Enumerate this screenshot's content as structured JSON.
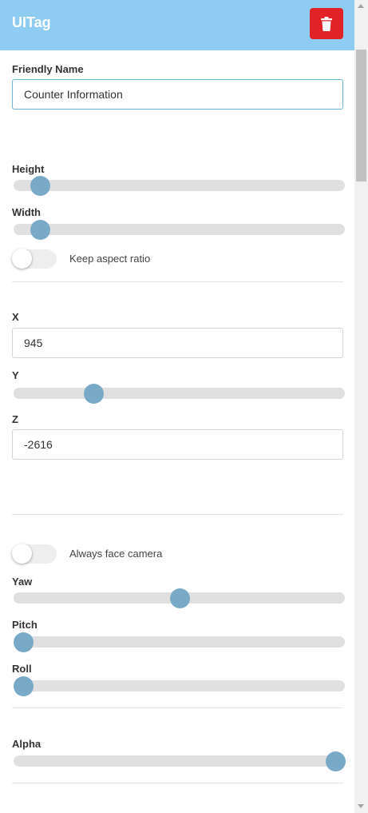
{
  "header": {
    "title": "UITag",
    "delete_icon": "trash-icon",
    "background": "#8ecdf1",
    "delete_color": "#e12226"
  },
  "friendly_name": {
    "label": "Friendly Name",
    "value": "Counter Information"
  },
  "size": {
    "height_label": "Height",
    "height_fraction": 0.08,
    "width_label": "Width",
    "width_fraction": 0.08,
    "keep_aspect_label": "Keep aspect ratio",
    "keep_aspect_on": false
  },
  "position": {
    "x_label": "X",
    "x_value": "945",
    "y_label": "Y",
    "y_fraction": 0.24,
    "z_label": "Z",
    "z_value": "-2616"
  },
  "rotation": {
    "face_camera_label": "Always face camera",
    "face_camera_on": false,
    "yaw_label": "Yaw",
    "yaw_fraction": 0.5,
    "pitch_label": "Pitch",
    "pitch_fraction": 0.03,
    "roll_label": "Roll",
    "roll_fraction": 0.03
  },
  "appearance": {
    "alpha_label": "Alpha",
    "alpha_fraction": 0.97
  },
  "colors": {
    "accent": "#78a9c6",
    "track": "#e0e0e0"
  }
}
